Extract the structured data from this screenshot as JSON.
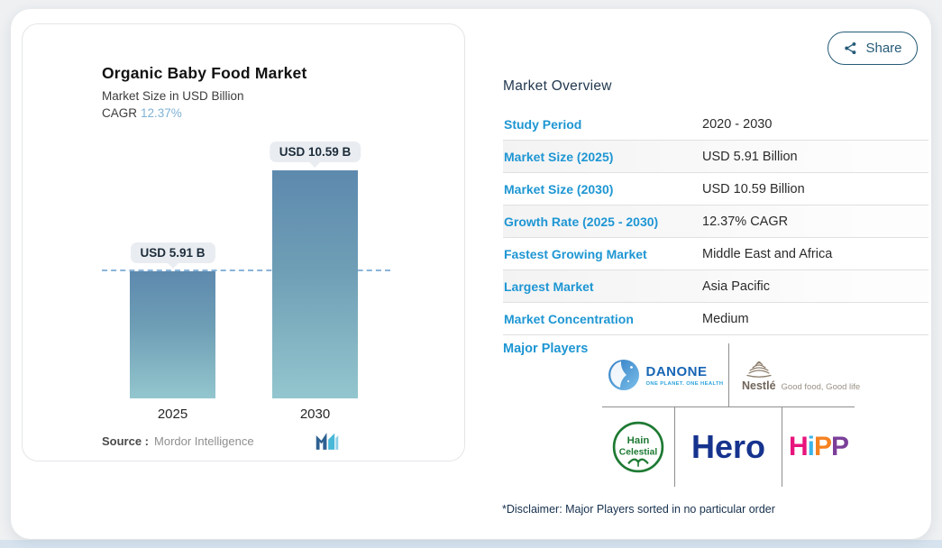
{
  "header": {
    "share_label": "Share"
  },
  "chart_card": {
    "title": "Organic Baby Food Market",
    "subtitle": "Market Size in USD Billion",
    "cagr_label": "CAGR",
    "cagr_value": "12.37%",
    "source_label": "Source :",
    "source_name": "Mordor Intelligence"
  },
  "chart_data": {
    "type": "bar",
    "title": "Organic Baby Food Market",
    "ylabel": "Market Size in USD Billion",
    "cagr": "12.37%",
    "categories": [
      "2025",
      "2030"
    ],
    "values": [
      5.91,
      10.59
    ],
    "bar_labels": [
      "USD 5.91 B",
      "USD 10.59 B"
    ],
    "reference_line": {
      "style": "dashed",
      "at": 5.91
    },
    "grid": "off",
    "legend": "none",
    "colors": {
      "bar_gradient_top": "#5d89ae",
      "bar_gradient_bottom": "#93c6ce",
      "dashed_line": "#8ab4d9",
      "callout_bg": "#e9edf1",
      "callout_text": "#1d2c3a",
      "cagr_accent": "#7fb2d7"
    }
  },
  "overview": {
    "heading": "Market Overview",
    "label_color": "#1e96d3",
    "rows": [
      {
        "label": "Study Period",
        "value": "2020 - 2030"
      },
      {
        "label": "Market Size (2025)",
        "value": "USD 5.91 Billion"
      },
      {
        "label": "Market Size (2030)",
        "value": "USD 10.59 Billion"
      },
      {
        "label": "Growth Rate (2025 - 2030)",
        "value": "12.37% CAGR"
      },
      {
        "label": "Fastest Growing Market",
        "value": "Middle East and Africa"
      },
      {
        "label": "Largest Market",
        "value": "Asia Pacific"
      },
      {
        "label": "Market Concentration",
        "value": "Medium"
      }
    ]
  },
  "major_players": {
    "heading": "Major Players",
    "danone": {
      "name": "DANONE",
      "tagline": "ONE PLANET. ONE HEALTH"
    },
    "nestle": {
      "name": "Nestlé",
      "tagline": "Good food, Good life"
    },
    "hain": {
      "line1": "Hain",
      "line2": "Celestial"
    },
    "hero": {
      "name": "Hero"
    },
    "hipp": {
      "letters": [
        "H",
        "i",
        "P",
        "P"
      ],
      "colors": [
        "#e8147d",
        "#3ab5e9",
        "#f58220",
        "#7b3f99"
      ]
    },
    "disclaimer": "*Disclaimer: Major Players sorted in no particular order"
  }
}
